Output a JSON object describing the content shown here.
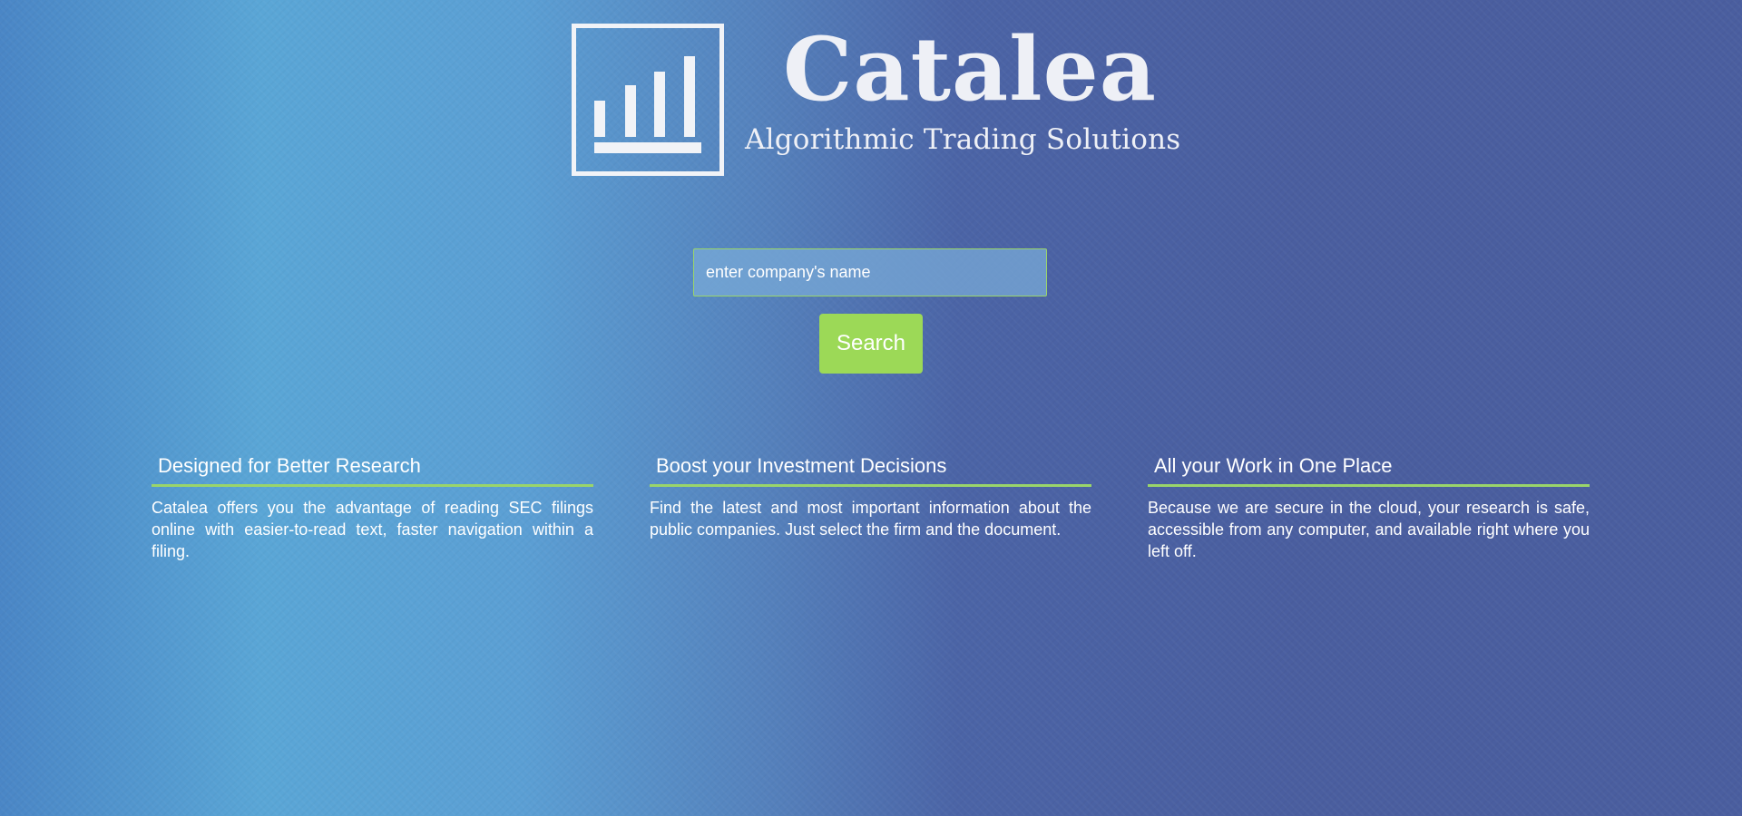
{
  "brand": {
    "name": "Catalea",
    "tagline": "Algorithmic Trading Solutions"
  },
  "search": {
    "placeholder": "enter company's name",
    "button_label": "Search"
  },
  "features": [
    {
      "title": "Designed for Better Research",
      "text": "Catalea offers you the advantage of reading SEC filings online with easier-to-read text, faster navigation within a filing."
    },
    {
      "title": "Boost your Investment Decisions",
      "text": "Find the latest and most important information about the public companies. Just select the firm and the document."
    },
    {
      "title": "All your Work in One Place",
      "text": "Because we are secure in the cloud, your research is safe, accessible from any computer, and available right where you left off."
    }
  ],
  "colors": {
    "accent_green": "#9cd957",
    "background_blue_light": "#5aa6d6",
    "background_blue_dark": "#4a5e9f",
    "logo_white": "#f1f3f7"
  },
  "icons": {
    "logo": "bar-chart-icon"
  }
}
